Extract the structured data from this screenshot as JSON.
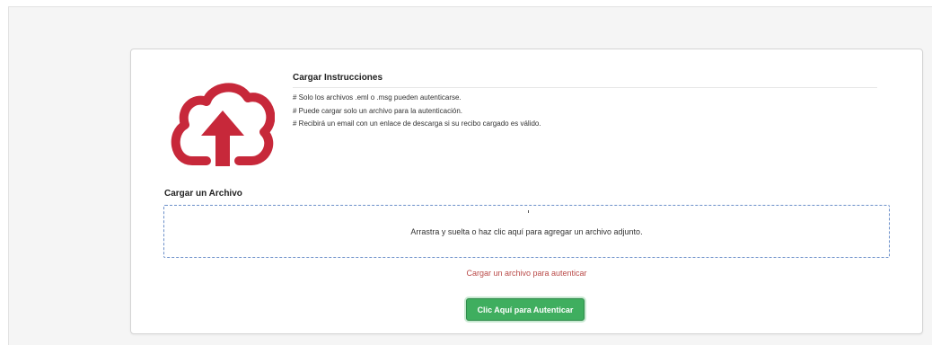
{
  "instructions": {
    "title": "Cargar Instrucciones",
    "items": [
      "# Solo los archivos .eml o .msg pueden autenticarse.",
      "# Puede cargar solo un archivo para la autenticación.",
      "# Recibirá un email con un enlace de descarga si su recibo cargado es válido."
    ]
  },
  "upload": {
    "label": "Cargar un Archivo",
    "dropzone_text": "Arrastra y suelta o haz clic aquí para agregar un archivo adjunto.",
    "status_text": "Cargar un archivo para autenticar"
  },
  "actions": {
    "authenticate_label": "Clic Aquí para Autenticar"
  },
  "icons": {
    "logo": "cloud-upload-icon"
  },
  "colors": {
    "logo_red": "#c7283a",
    "button_green": "#3fae5f",
    "status_red": "#b94a48",
    "dropzone_border": "#6b8fc9"
  }
}
